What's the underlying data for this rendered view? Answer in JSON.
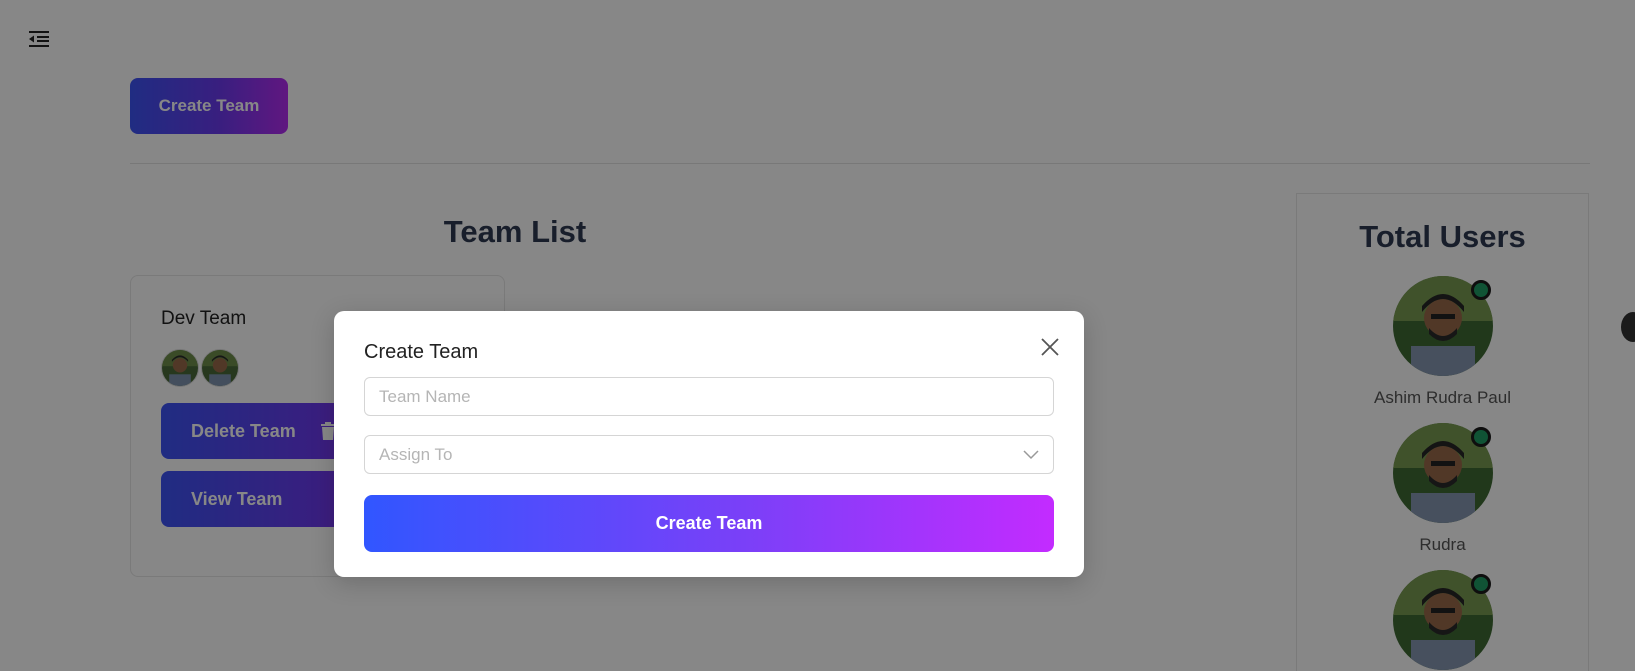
{
  "header": {
    "menu_icon": "menu-collapse-icon",
    "create_team_label": "Create Team"
  },
  "team_list": {
    "title": "Team List",
    "teams": [
      {
        "name": "Dev Team",
        "member_avatars": 2,
        "delete_label": "Delete Team",
        "view_label": "View Team"
      }
    ]
  },
  "users_panel": {
    "title": "Total Users",
    "users": [
      {
        "name": "Ashim Rudra Paul",
        "status": "online"
      },
      {
        "name": "Rudra",
        "status": "online"
      },
      {
        "name": "",
        "status": "online"
      }
    ]
  },
  "modal": {
    "title": "Create Team",
    "team_name_placeholder": "Team Name",
    "assign_to_placeholder": "Assign To",
    "submit_label": "Create Team",
    "close_icon": "close-icon"
  },
  "colors": {
    "gradient_start": "#3156ff",
    "gradient_end": "#c32bff",
    "online": "#1f9d65",
    "overlay": "rgba(0,0,0,0.47)"
  }
}
